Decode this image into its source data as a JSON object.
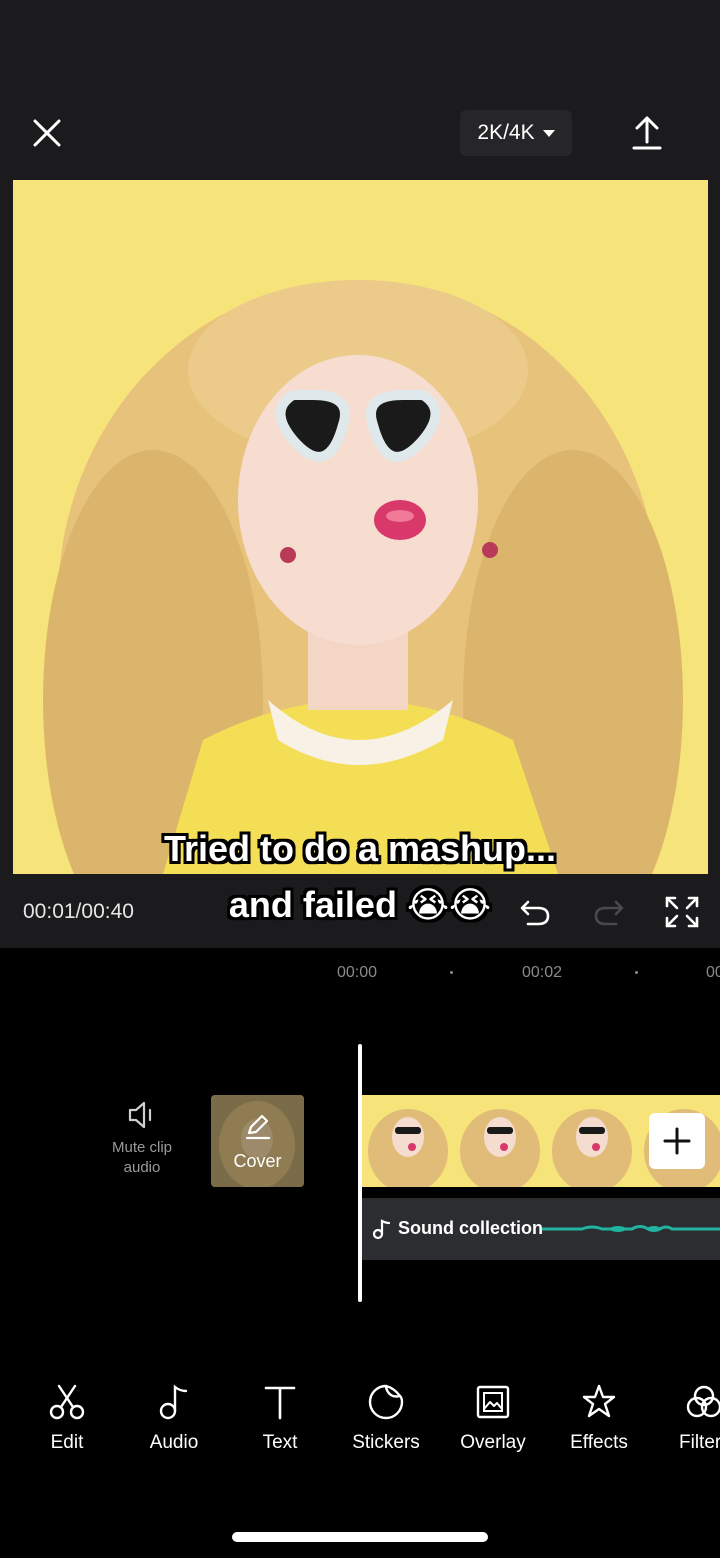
{
  "header": {
    "resolution_label": "2K/4K"
  },
  "preview": {
    "caption_line1": "Tried to do a mashup...",
    "caption_line2": "and failed 😭😭"
  },
  "controls": {
    "timecode": "00:01/00:40"
  },
  "timeline": {
    "ruler_labels": [
      "00:00",
      "00:02",
      "00"
    ],
    "mute_label": "Mute clip audio",
    "cover_label": "Cover",
    "audio_track_label": "Sound collection"
  },
  "toolbar": {
    "items": [
      {
        "label": "Edit",
        "icon": "scissors-icon"
      },
      {
        "label": "Audio",
        "icon": "music-note-icon"
      },
      {
        "label": "Text",
        "icon": "text-icon"
      },
      {
        "label": "Stickers",
        "icon": "sticker-icon"
      },
      {
        "label": "Overlay",
        "icon": "overlay-icon"
      },
      {
        "label": "Effects",
        "icon": "effects-star-icon"
      },
      {
        "label": "Filter",
        "icon": "filter-icon"
      }
    ]
  },
  "colors": {
    "preview_background": "#f6e37a",
    "audio_wave": "#1fb3a0",
    "panel": "#1b1b1d"
  }
}
